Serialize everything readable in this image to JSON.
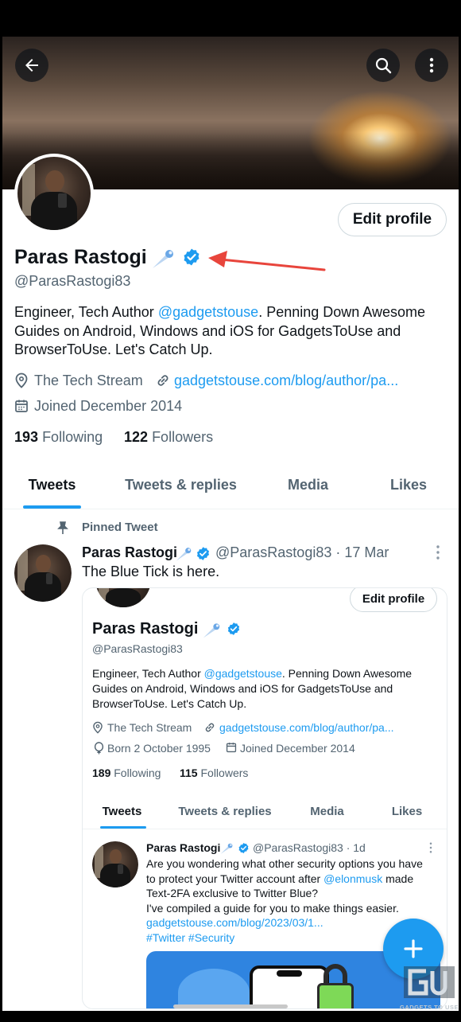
{
  "profile": {
    "name": "Paras Rastogi",
    "handle": "@ParasRastogi83",
    "edit_label": "Edit profile",
    "bio_part1": "Engineer, Tech Author ",
    "bio_mention": "@gadgetstouse",
    "bio_line1_rest": ".  Penning Down Awesome",
    "bio_line2": "Guides on Android, Windows and iOS for GadgetsToUse and",
    "bio_line3": "BrowserToUse.  Let's Catch Up.",
    "location": "The Tech Stream",
    "website": "gadgetstouse.com/blog/author/pa...",
    "joined": "Joined December 2014",
    "following_count": "193",
    "following_label": "Following",
    "followers_count": "122",
    "followers_label": "Followers"
  },
  "tabs": [
    "Tweets",
    "Tweets & replies",
    "Media",
    "Likes"
  ],
  "pinned": {
    "label": "Pinned Tweet",
    "author": "Paras Rastogi",
    "handle_date": "@ParasRastogi83 · 17 Mar",
    "text": "The Blue Tick is here."
  },
  "embedded": {
    "edit_label": "Edit profile",
    "name": "Paras Rastogi",
    "handle": "@ParasRastogi83",
    "bio_part1": "Engineer, Tech Author ",
    "bio_mention": "@gadgetstouse",
    "bio_line1_rest": ".  Penning Down Awesome",
    "bio_line2": "Guides on Android, Windows and iOS for GadgetsToUse and",
    "bio_line3": "BrowserToUse.  Let's Catch Up.",
    "location": "The Tech Stream",
    "website": "gadgetstouse.com/blog/author/pa...",
    "born": "Born 2 October 1995",
    "joined": "Joined December 2014",
    "following_count": "189",
    "following_label": "Following",
    "followers_count": "115",
    "followers_label": "Followers",
    "tabs": [
      "Tweets",
      "Tweets & replies",
      "Media",
      "Likes"
    ],
    "tweet": {
      "author": "Paras Rastogi",
      "handle_date": "@ParasRastogi83 · 1d",
      "line1": "Are you wondering what other security options you have",
      "line2_a": "to protect your Twitter account after ",
      "line2_mention": "@elonmusk",
      "line2_b": " made",
      "line3": "Text-2FA exclusive to Twitter Blue?",
      "line4": "I've compiled a guide for you to make things easier.",
      "link": "gadgetstouse.com/blog/2023/03/1...",
      "hashtags": "#Twitter #Security"
    }
  },
  "watermark": "GADGETS TO USE",
  "colors": {
    "accent": "#1d9bf0",
    "text": "#0f1419",
    "muted": "#536471",
    "annotation_arrow": "#e8453c"
  },
  "icons": [
    "back-arrow-icon",
    "search-icon",
    "more-vertical-icon",
    "verified-badge-icon",
    "blue-comet-icon",
    "location-pin-icon",
    "link-icon",
    "calendar-icon",
    "balloon-icon",
    "pin-icon",
    "plus-icon"
  ]
}
